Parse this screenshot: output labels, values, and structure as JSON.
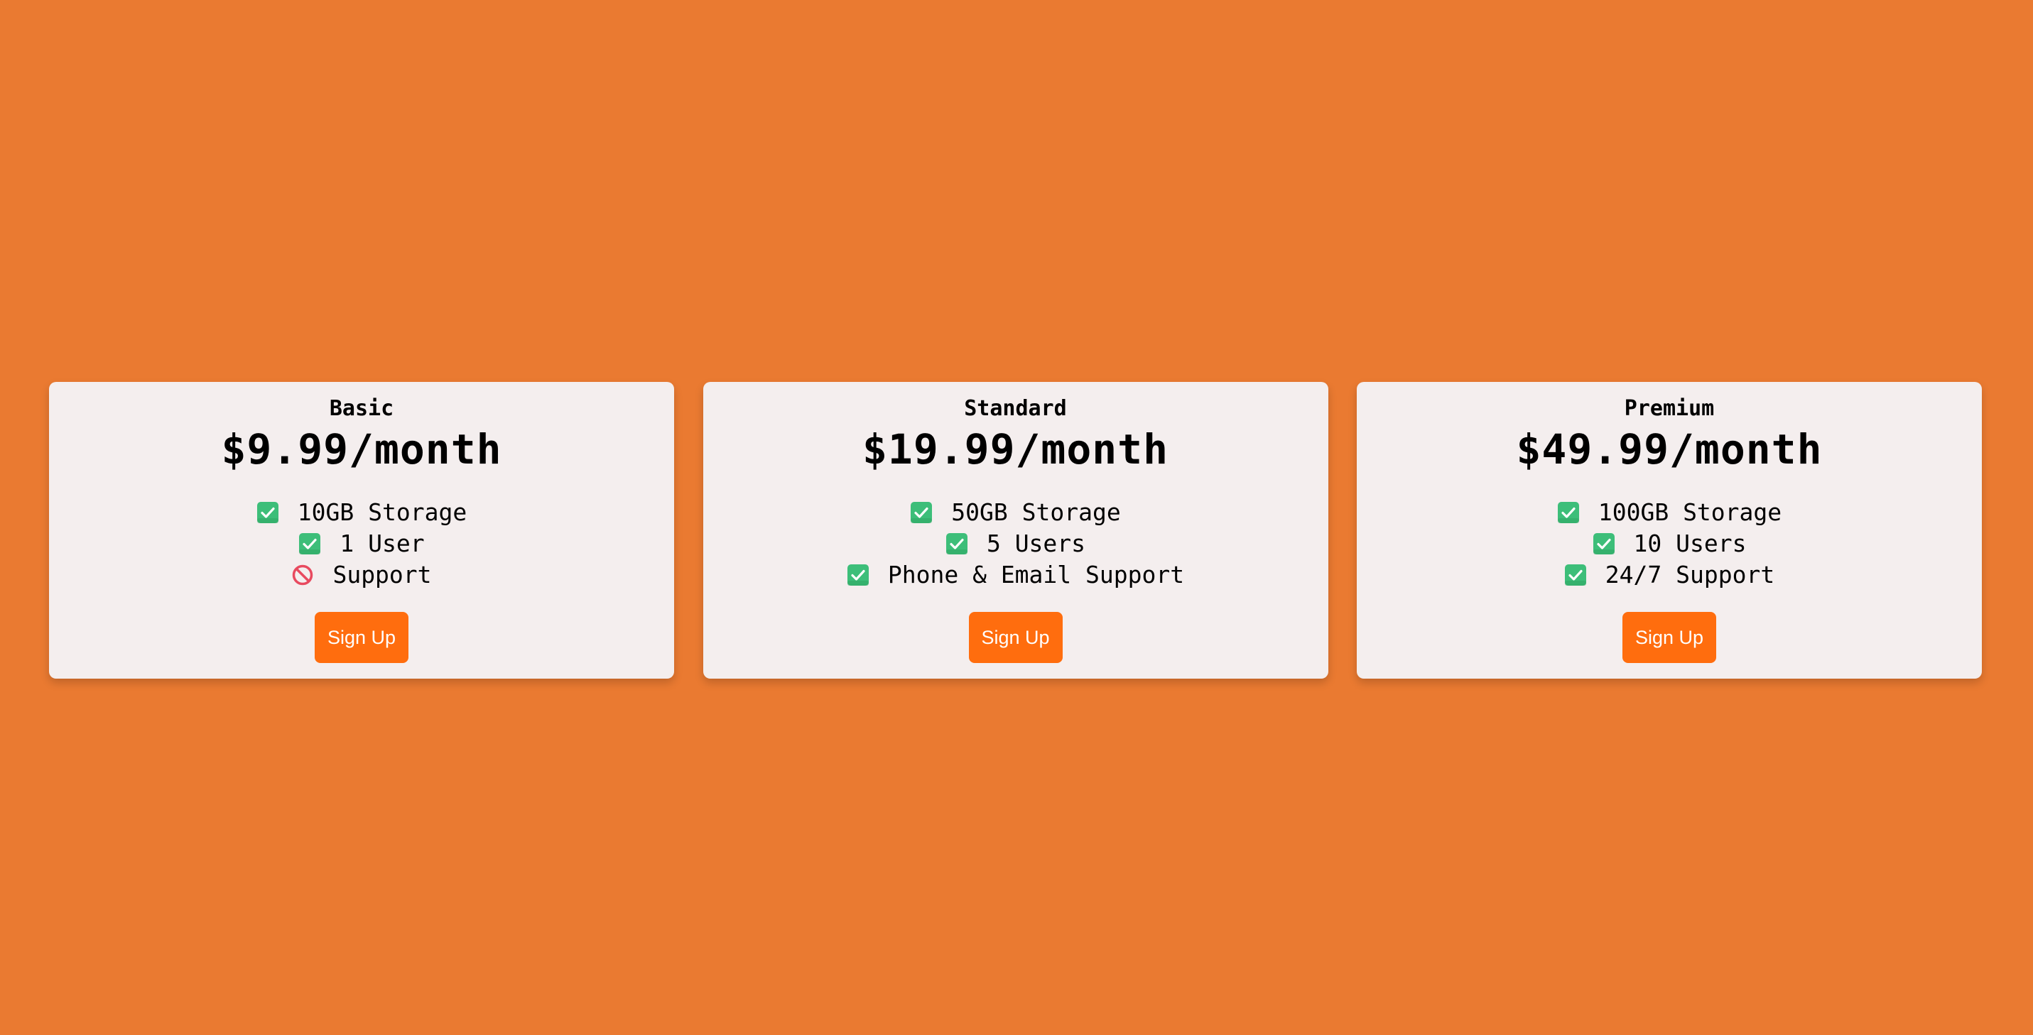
{
  "colors": {
    "background": "#EA7A31",
    "card": "#F4EEEE",
    "button": "#FF6D0E",
    "check": "#3DBE79",
    "cross": "#E84A5F"
  },
  "plans": [
    {
      "name": "Basic",
      "price": "$9.99/month",
      "features": [
        {
          "icon": "check-icon",
          "text": "10GB Storage"
        },
        {
          "icon": "check-icon",
          "text": "1 User"
        },
        {
          "icon": "prohibited-icon",
          "text": "Support"
        }
      ],
      "button_label": "Sign Up"
    },
    {
      "name": "Standard",
      "price": "$19.99/month",
      "features": [
        {
          "icon": "check-icon",
          "text": "50GB Storage"
        },
        {
          "icon": "check-icon",
          "text": "5 Users"
        },
        {
          "icon": "check-icon",
          "text": "Phone & Email Support"
        }
      ],
      "button_label": "Sign Up"
    },
    {
      "name": "Premium",
      "price": "$49.99/month",
      "features": [
        {
          "icon": "check-icon",
          "text": "100GB Storage"
        },
        {
          "icon": "check-icon",
          "text": "10 Users"
        },
        {
          "icon": "check-icon",
          "text": "24/7 Support"
        }
      ],
      "button_label": "Sign Up"
    }
  ]
}
